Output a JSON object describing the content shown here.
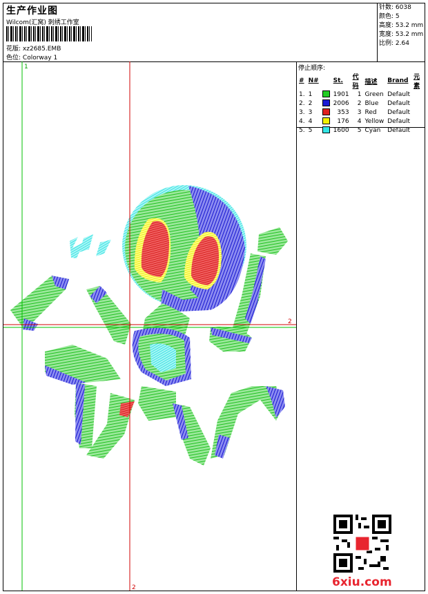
{
  "header": {
    "title": "生产作业图",
    "subtitle": "Wilcom(汇窝) 刺绣工作室",
    "pattern_label": "花版:",
    "pattern_value": "xz2685.EMB",
    "color_label": "色位:",
    "color_value": "Colorway 1"
  },
  "stats": {
    "stitches": "针数: 6038",
    "colors": "颜色: 5",
    "height": "高度: 53.2 mm",
    "width": "宽度: 53.2 mm",
    "ratio": "比例: 2.64"
  },
  "stop_sequence": {
    "title": "停止顺序:",
    "headers": [
      "#",
      "N#",
      "St.",
      "代码",
      "描述",
      "Brand",
      "元素"
    ],
    "rows": [
      {
        "num": "1.",
        "n": "1",
        "color": "#22cc22",
        "st": "1901",
        "code": "1",
        "desc": "Green",
        "brand": "Default"
      },
      {
        "num": "2.",
        "n": "2",
        "color": "#1a1ad6",
        "st": "2006",
        "code": "2",
        "desc": "Blue",
        "brand": "Default"
      },
      {
        "num": "3.",
        "n": "3",
        "color": "#e02020",
        "st": "353",
        "code": "3",
        "desc": "Red",
        "brand": "Default"
      },
      {
        "num": "4.",
        "n": "4",
        "color": "#f2f200",
        "st": "176",
        "code": "4",
        "desc": "Yellow",
        "brand": "Default"
      },
      {
        "num": "5.",
        "n": "5",
        "color": "#33e6e6",
        "st": "1600",
        "code": "5",
        "desc": "Cyan",
        "brand": "Default"
      }
    ]
  },
  "guides": {
    "v1": "1",
    "h2": "2",
    "v2": "2"
  },
  "watermark": "6xiu.com",
  "colors": {
    "green": "#22cc22",
    "blue": "#1a1ad6",
    "red": "#e02020",
    "yellow": "#f2f200",
    "cyan": "#33e6e6",
    "guide_green": "#00c000",
    "guide_red": "#d00000"
  }
}
